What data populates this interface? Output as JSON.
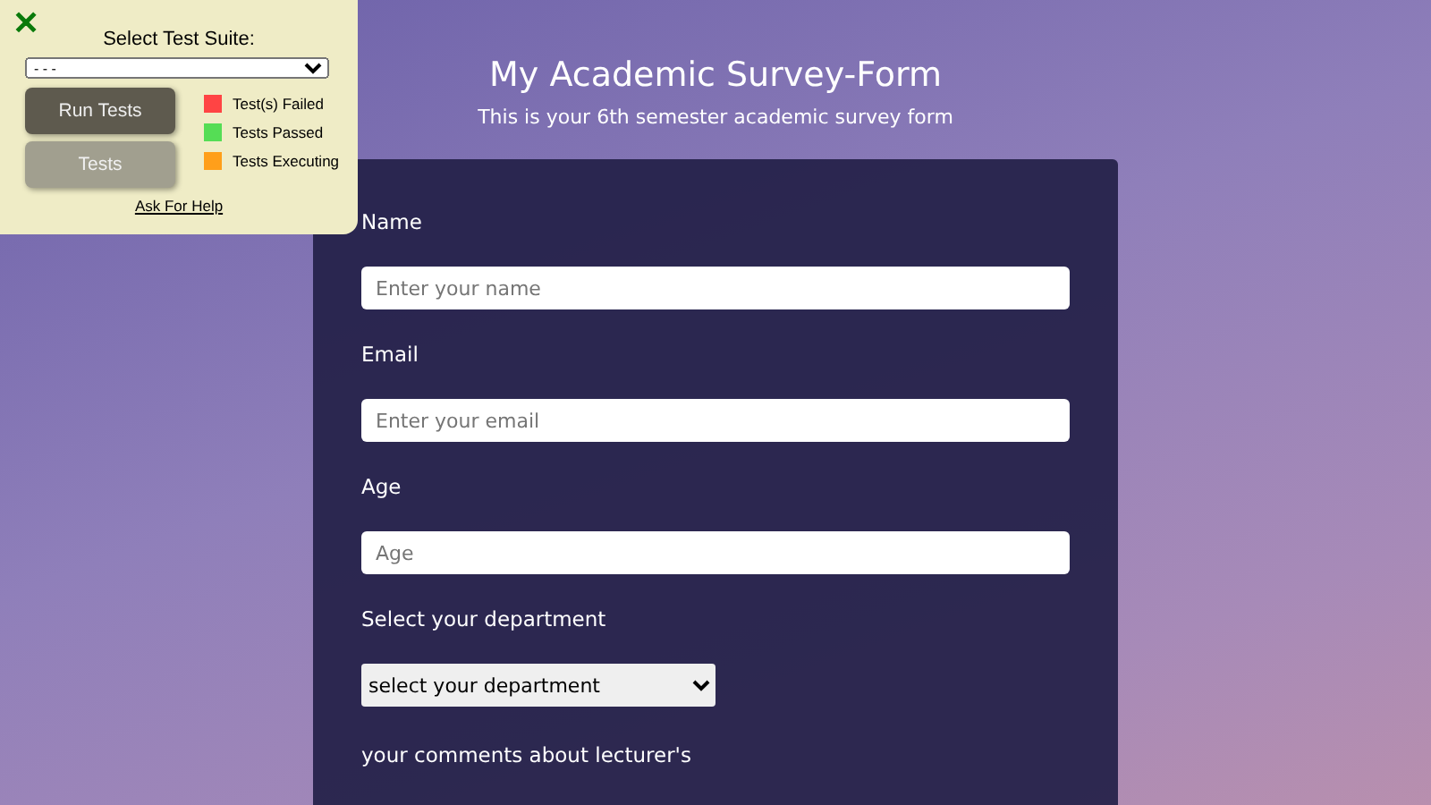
{
  "header": {
    "title": "My Academic Survey-Form",
    "subtitle": "This is your 6th semester academic survey form"
  },
  "form": {
    "fields": [
      {
        "kind": "input",
        "label": "Name",
        "placeholder": "Enter your name"
      },
      {
        "kind": "input",
        "label": "Email",
        "placeholder": "Enter your email"
      },
      {
        "kind": "input",
        "label": "Age",
        "placeholder": "Age"
      },
      {
        "kind": "select",
        "label": "Select your department",
        "value": "select your department"
      },
      {
        "kind": "heading",
        "label": "your comments about lecturer's"
      }
    ]
  },
  "test_panel": {
    "close": "✕",
    "title": "Select Test Suite:",
    "suite_value": "- - -",
    "buttons": [
      {
        "label": "Run Tests",
        "kind": "dark"
      },
      {
        "label": "Tests",
        "kind": "light"
      }
    ],
    "legend": [
      {
        "label": "Test(s) Failed",
        "color": "#ff4444"
      },
      {
        "label": "Tests Passed",
        "color": "#55dd55"
      },
      {
        "label": "Tests Executing",
        "color": "#ff9f1a"
      }
    ],
    "help_link": "Ask For Help"
  }
}
